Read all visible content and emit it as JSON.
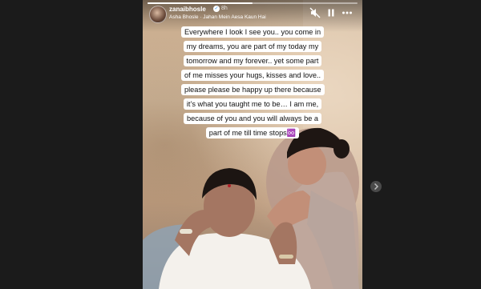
{
  "story": {
    "username": "zanaibhosle",
    "time_ago": "8h",
    "music": "Asha Bhosle · Jahan Mein Aesa Kaun Hai",
    "caption": "Everywhere I look I see you.. you come in my dreams, you are part of my today my tomorrow and my forever.. yet some part of me misses your hugs, kisses and love.. please please be happy up there because it’s what you taught me to be… I am me, because of you and you will always be a part of me till time stops♾️",
    "progress": 0.5
  },
  "controls": {
    "mute_icon": "mute-icon",
    "pause_icon": "pause-icon",
    "more_icon": "more-options-icon",
    "next_icon": "chevron-right-icon"
  },
  "colors": {
    "page_background": "#1b1b1b",
    "caption_background": "#ffffff",
    "caption_text": "#111111"
  }
}
